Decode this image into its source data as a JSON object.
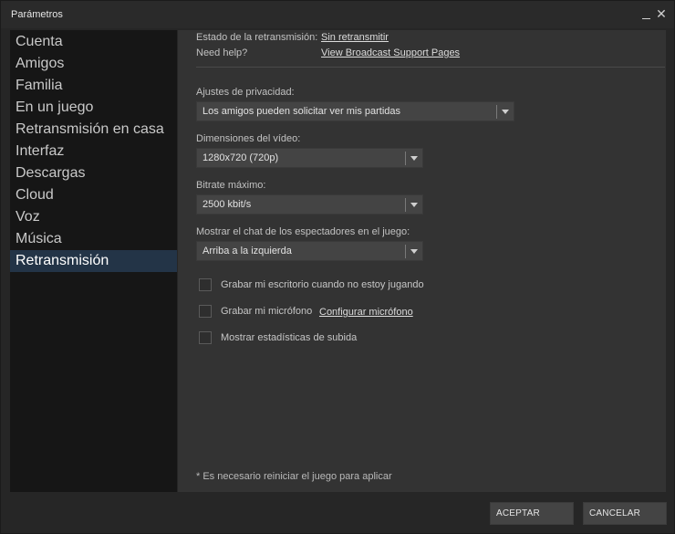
{
  "window": {
    "title": "Parámetros",
    "minimize": "_",
    "close": "✕"
  },
  "sidebar": {
    "items": [
      {
        "label": "Cuenta"
      },
      {
        "label": "Amigos"
      },
      {
        "label": "Familia"
      },
      {
        "label": "En un juego"
      },
      {
        "label": "Retransmisión en casa"
      },
      {
        "label": "Interfaz"
      },
      {
        "label": "Descargas"
      },
      {
        "label": "Cloud"
      },
      {
        "label": "Voz"
      },
      {
        "label": "Música"
      },
      {
        "label": "Retransmisión"
      }
    ],
    "active": "Retransmisión"
  },
  "status": {
    "label": "Estado de la retransmisión:",
    "value": "Sin retransmitir",
    "help_label": "Need help?",
    "help_link": "View Broadcast Support Pages"
  },
  "settings": {
    "privacy": {
      "label": "Ajustes de privacidad:",
      "value": "Los amigos pueden solicitar ver mis partidas"
    },
    "dimensions": {
      "label": "Dimensiones del vídeo:",
      "value": "1280x720 (720p)"
    },
    "bitrate": {
      "label": "Bitrate máximo:",
      "value": "2500 kbit/s"
    },
    "chat": {
      "label": "Mostrar el chat de los espectadores en el juego:",
      "value": "Arriba a la izquierda"
    }
  },
  "checkboxes": {
    "record_desktop": {
      "label": "Grabar mi escritorio cuando no estoy jugando",
      "checked": false
    },
    "record_mic": {
      "label": "Grabar mi micrófono",
      "checked": false,
      "link": "Configurar micrófono"
    },
    "upload_stats": {
      "label": "Mostrar estadísticas de subida",
      "checked": false
    }
  },
  "footnote": "* Es necesario reiniciar el juego para aplicar",
  "buttons": {
    "ok": "ACEPTAR",
    "cancel": "CANCELAR"
  }
}
